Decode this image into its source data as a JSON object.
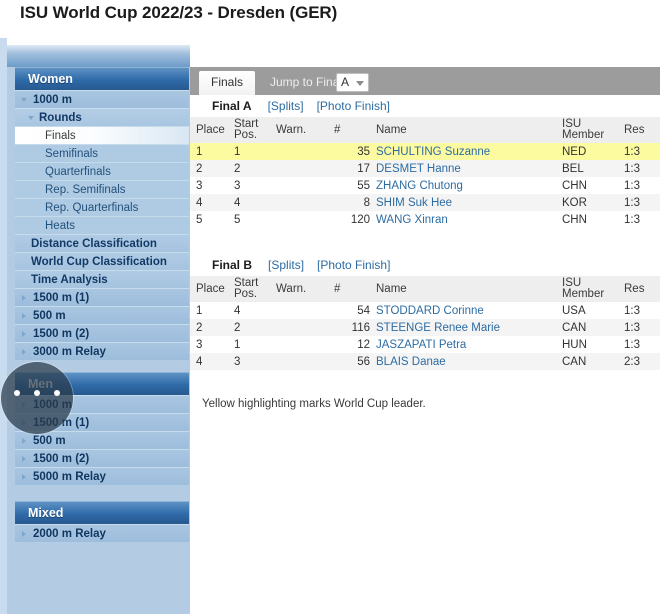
{
  "header": {
    "title": "ISU World Cup 2022/23 - Dresden (GER)"
  },
  "sidebar": {
    "sections": [
      {
        "name": "Women",
        "label": "Women",
        "items": [
          {
            "label": "1000 m",
            "level": 1,
            "marker": "chevron-down-icon",
            "expanded": true
          },
          {
            "label": "Rounds",
            "level": 2,
            "marker": "chevron-down-icon",
            "expanded": true
          },
          {
            "label": "Finals",
            "level": 3,
            "selected": true
          },
          {
            "label": "Semifinals",
            "level": 3
          },
          {
            "label": "Quarterfinals",
            "level": 3
          },
          {
            "label": "Rep. Semifinals",
            "level": 3
          },
          {
            "label": "Rep. Quarterfinals",
            "level": 3
          },
          {
            "label": "Heats",
            "level": 3
          },
          {
            "label": "Distance Classification",
            "level": 2,
            "plain": true
          },
          {
            "label": "World Cup Classification",
            "level": 2,
            "plain": true
          },
          {
            "label": "Time Analysis",
            "level": 2,
            "plain": true
          },
          {
            "label": "1500 m (1)",
            "level": 1,
            "marker": "chevron-right-icon"
          },
          {
            "label": "500 m",
            "level": 1,
            "marker": "chevron-right-icon"
          },
          {
            "label": "1500 m (2)",
            "level": 1,
            "marker": "chevron-right-icon"
          },
          {
            "label": "3000 m Relay",
            "level": 1,
            "marker": "chevron-right-icon"
          }
        ]
      },
      {
        "name": "Men",
        "label": "Men",
        "items": [
          {
            "label": "1000 m",
            "level": 1,
            "marker": "chevron-right-icon"
          },
          {
            "label": "1500 m (1)",
            "level": 1,
            "marker": "chevron-right-icon"
          },
          {
            "label": "500 m",
            "level": 1,
            "marker": "chevron-right-icon"
          },
          {
            "label": "1500 m (2)",
            "level": 1,
            "marker": "chevron-right-icon"
          },
          {
            "label": "5000 m Relay",
            "level": 1,
            "marker": "chevron-right-icon"
          }
        ]
      },
      {
        "name": "Mixed",
        "label": "Mixed",
        "items": [
          {
            "label": "2000 m Relay",
            "level": 1,
            "marker": "chevron-right-icon"
          }
        ]
      }
    ]
  },
  "tabs": {
    "active_label": "Finals",
    "jump_label": "Jump to Final",
    "select_value": "A"
  },
  "finals": [
    {
      "title": "Final A",
      "splits_label": "[Splits]",
      "photo_label": "[Photo Finish]",
      "columns": [
        "Place",
        "Start Pos.",
        "Warn.",
        "#",
        "Name",
        "ISU Member",
        "Res"
      ],
      "rows": [
        {
          "place": "1",
          "start": "1",
          "warn": "",
          "num": "35",
          "name": "SCHULTING Suzanne",
          "isu": "NED",
          "result": "1:3",
          "leader": true
        },
        {
          "place": "2",
          "start": "2",
          "warn": "",
          "num": "17",
          "name": "DESMET Hanne",
          "isu": "BEL",
          "result": "1:3"
        },
        {
          "place": "3",
          "start": "3",
          "warn": "",
          "num": "55",
          "name": "ZHANG Chutong",
          "isu": "CHN",
          "result": "1:3"
        },
        {
          "place": "4",
          "start": "4",
          "warn": "",
          "num": "8",
          "name": "SHIM Suk Hee",
          "isu": "KOR",
          "result": "1:3"
        },
        {
          "place": "5",
          "start": "5",
          "warn": "",
          "num": "120",
          "name": "WANG Xinran",
          "isu": "CHN",
          "result": "1:3"
        }
      ]
    },
    {
      "title": "Final B",
      "splits_label": "[Splits]",
      "photo_label": "[Photo Finish]",
      "columns": [
        "Place",
        "Start Pos.",
        "Warn.",
        "#",
        "Name",
        "ISU Member",
        "Res"
      ],
      "rows": [
        {
          "place": "1",
          "start": "4",
          "warn": "",
          "num": "54",
          "name": "STODDARD Corinne",
          "isu": "USA",
          "result": "1:3"
        },
        {
          "place": "2",
          "start": "2",
          "warn": "",
          "num": "116",
          "name": "STEENGE Renee Marie",
          "isu": "CAN",
          "result": "1:3"
        },
        {
          "place": "3",
          "start": "1",
          "warn": "",
          "num": "12",
          "name": "JASZAPATI Petra",
          "isu": "HUN",
          "result": "1:3"
        },
        {
          "place": "4",
          "start": "3",
          "warn": "",
          "num": "56",
          "name": "BLAIS Danae",
          "isu": "CAN",
          "result": "2:3"
        }
      ]
    }
  ],
  "footnote": "Yellow highlighting marks World Cup leader.",
  "gesture_overlay": {
    "label": "touch-gesture-indicator",
    "dots": 3
  },
  "colors": {
    "accent_blue": "#2f6aa8",
    "sidebar_bg": "#b3cce4",
    "leader_yellow": "#fdfba0",
    "link_blue": "#2d6ca2",
    "tabstrip_gray": "#9c9c9c"
  }
}
